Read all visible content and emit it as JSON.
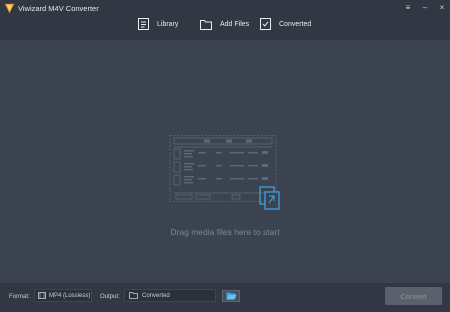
{
  "app": {
    "title": "Viwizard M4V Converter",
    "accent_color": "#f2a83b",
    "logo_icon": "viwizard-logo-icon"
  },
  "window_controls": {
    "menu_icon": "list-icon",
    "minimize_icon": "minimize-icon",
    "close_icon": "close-icon",
    "menu": "≡",
    "minimize": "–",
    "close": "×"
  },
  "nav": {
    "library": {
      "label": "Library",
      "icon": "library-icon"
    },
    "add_files": {
      "label": "Add Files",
      "icon": "folder-icon"
    },
    "converted": {
      "label": "Converted",
      "icon": "converted-icon"
    }
  },
  "drop_area": {
    "hint": "Drag media files here to start",
    "illustration_icon": "drag-files-illustration"
  },
  "bottom": {
    "format_label": "Format:",
    "format_value": "MP4 (Lossless)",
    "format_icon": "film-icon",
    "output_label": "Output:",
    "output_value": "Converted",
    "output_icon": "folder-icon",
    "browse_icon": "open-folder-icon",
    "convert_label": "Convert"
  },
  "colors": {
    "background": "#3c4350",
    "bars": "#323843",
    "browse_icon": "#3ea7e8",
    "convert_disabled": "#5a616d"
  }
}
